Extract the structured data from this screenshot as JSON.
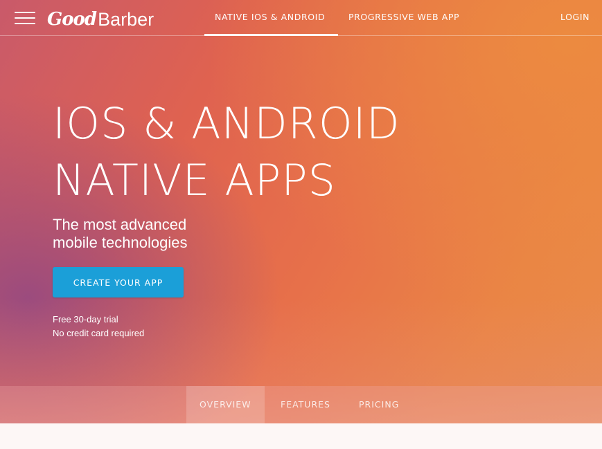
{
  "header": {
    "logo": {
      "part1": "Good",
      "part2": "Barber"
    },
    "nav": {
      "native": "NATIVE IOS & ANDROID",
      "pwa": "PROGRESSIVE WEB APP",
      "login": "LOGIN"
    }
  },
  "hero": {
    "headline_line1": "IOS & ANDROID",
    "headline_line2": "NATIVE APPS",
    "subtitle_line1": "The most advanced",
    "subtitle_line2": "mobile technologies",
    "cta_label": "CREATE YOUR APP",
    "trial_line1": "Free 30-day trial",
    "trial_line2": "No credit card required"
  },
  "subnav": {
    "overview": "OVERVIEW",
    "features": "FEATURES",
    "pricing": "PRICING"
  },
  "colors": {
    "cta": "#1b9fd8",
    "hero_orange": "#e98b4a",
    "hero_purple": "#984a80"
  }
}
